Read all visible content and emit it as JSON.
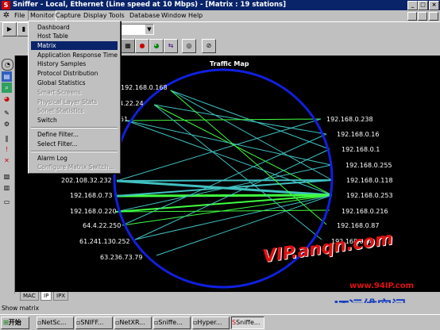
{
  "window": {
    "title": "Sniffer - Local, Ethernet (Line speed at 10 Mbps) - [Matrix : 19 stations]",
    "app_icon": "S",
    "minimize": "_",
    "maximize": "□",
    "close": "×"
  },
  "menubar": [
    "File",
    "Monitor",
    "Capture",
    "Display",
    "Tools",
    "Database",
    "Window",
    "Help"
  ],
  "monitor_menu": {
    "items": [
      {
        "label": "Dashboard",
        "state": "normal"
      },
      {
        "label": "Host Table",
        "state": "normal"
      },
      {
        "label": "Matrix",
        "state": "highlighted"
      },
      {
        "label": "Application Response Time",
        "state": "normal"
      },
      {
        "label": "History Samples",
        "state": "normal"
      },
      {
        "label": "Protocol Distribution",
        "state": "normal"
      },
      {
        "label": "Global Statistics",
        "state": "normal"
      },
      {
        "label": "Smart Screens",
        "state": "disabled"
      },
      {
        "label": "Physical Layer Stats",
        "state": "disabled"
      },
      {
        "label": "Sonet Statistics",
        "state": "disabled"
      },
      {
        "label": "Switch",
        "state": "normal"
      },
      {
        "label": "Define Filter...",
        "state": "normal"
      },
      {
        "label": "Select Filter...",
        "state": "normal"
      },
      {
        "label": "Alarm Log",
        "state": "normal"
      },
      {
        "label": "Configure Matrix Switch...",
        "state": "disabled"
      }
    ]
  },
  "traffic_map": {
    "title": "Traffic Map",
    "left_labels": [
      "192.168.0.168",
      "4.22.24",
      "51",
      "202.108.32.232",
      "192.168.0.73",
      "192.168.0.220",
      "64.4.22.250",
      "61.241.130.252",
      "63.236.73.79"
    ],
    "right_labels": [
      "192.168.0.238",
      "192.168.0.16",
      "192.168.0.1",
      "192.168.0.255",
      "192.168.0.118",
      "192.168.0.253",
      "192.168.0.216",
      "192.168.0.87",
      "192.168.0.68"
    ]
  },
  "tabs": [
    "MAC",
    "IP",
    "IPX"
  ],
  "selected_tab": "IP",
  "status": "Show matrix",
  "taskbar": {
    "start": "开始",
    "tasks": [
      "NetSc...",
      "SNIFF...",
      "NetXR...",
      "Sniffe...",
      "Hyper...",
      "Sniffe..."
    ]
  },
  "watermark": {
    "main": "VIP.anqn.com",
    "site": "www.94IP.com",
    "brand": "IT运维空间"
  },
  "colors": {
    "titlebar": "#0a246a",
    "map_bg": "#000000",
    "ring": "#1020e0",
    "link_green": "#40ff40",
    "link_cyan": "#40c0c0"
  }
}
